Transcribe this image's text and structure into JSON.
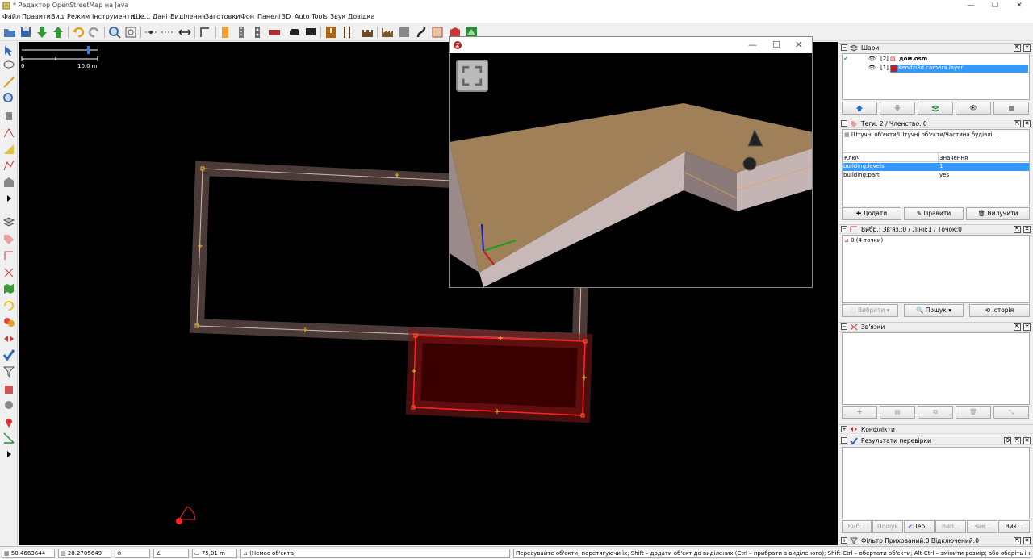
{
  "window": {
    "title": "* Редактор OpenStreetMap на Java",
    "minimize": "—",
    "maximize": "❐",
    "close": "✕"
  },
  "menu": [
    "Файл",
    "Правити",
    "Вид",
    "Режим",
    "Інструменти",
    "Ще...",
    "Дані",
    "Виділення",
    "Заготовки",
    "Фон",
    "Панелі",
    "3D",
    "Auto Tools",
    "Звук",
    "Довідка"
  ],
  "scale": {
    "start": "0",
    "end": "10.0 m"
  },
  "kendzi": {
    "minimize": "—",
    "maximize": "☐",
    "close": "✕"
  },
  "layers": {
    "title": "Шари",
    "items": [
      {
        "index": "[2]",
        "name": "дом.osm",
        "bold": true,
        "selected": false
      },
      {
        "index": "[1]",
        "name": "Kendzi3d camera layer",
        "bold": false,
        "selected": true
      }
    ]
  },
  "tags": {
    "title": "Теги: 2 / Членство: 0",
    "preset": "Штучні об'єкти/Штучні об'єкти/Частина будівлі ...",
    "col_key": "Ключ",
    "col_value": "Значення",
    "rows": [
      {
        "key": "building:levels",
        "value": "1",
        "selected": true
      },
      {
        "key": "building:part",
        "value": "yes",
        "selected": false
      }
    ],
    "buttons": {
      "add": "Додати",
      "edit": "Правити",
      "delete": "Вилучити"
    }
  },
  "selection": {
    "title": "Вибр.: Зв'яз.:0 / Лінії:1 / Точок:0",
    "items": [
      "0 (4 точки)"
    ],
    "buttons": {
      "select": "Вибрати",
      "search": "Пошук",
      "history": "Історія"
    }
  },
  "relations": {
    "title": "Зв'язки"
  },
  "conflicts": {
    "title": "Конфлікти"
  },
  "validation": {
    "title": "Результати перевірки",
    "buttons": [
      "Виб...",
      "Пошук",
      "Пер...",
      "Вип...",
      "Зне...",
      "Вик..."
    ]
  },
  "filter": {
    "title": "Фільтр Прихований:0 Відключений:0"
  },
  "status": {
    "lat": "50.4663644",
    "lon": "28.2705649",
    "distance": "75,01 m",
    "object": "(Немає об'єкта)",
    "help": "Пересувайте об'єкти, перетягуючи їх; Shift – додати об'єкт до виділених (Ctrl – прибрати з виділеного); Shift-Ctrl – обертати об'єкти; Alt-Ctrl – змінити розмір; або оберіть інший об'єкт"
  },
  "colors": {
    "selection_blue": "#3399ff",
    "selected_way": "#ff2020",
    "building_fill": "#4a3a38",
    "roof": "#a08058",
    "wall": "#c8b8b8"
  }
}
